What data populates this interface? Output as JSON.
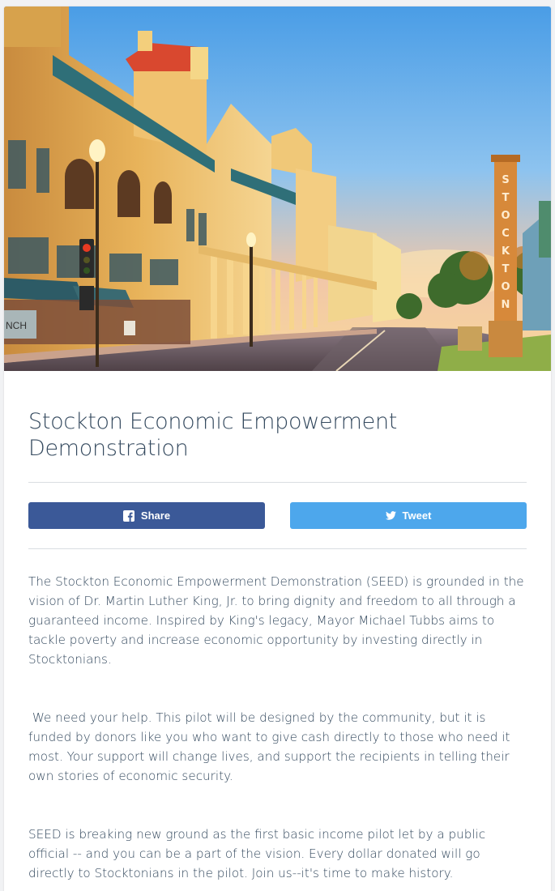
{
  "hero": {
    "image_alt": "Stockton street with historic hotel building and STOCKTON sign tower",
    "tower_letters": [
      "S",
      "T",
      "O",
      "C",
      "K",
      "T",
      "O",
      "N"
    ],
    "storefront_text": "NCH"
  },
  "campaign": {
    "title": "Stockton Economic Empowerment Demonstration"
  },
  "share": {
    "facebook_label": "Share",
    "facebook_icon": "facebook-icon",
    "facebook_color": "#3b5998",
    "twitter_label": "Tweet",
    "twitter_icon": "twitter-icon",
    "twitter_color": "#4da7ec"
  },
  "description": {
    "paragraph_1": "The Stockton Economic Empowerment Demonstration (SEED) is grounded in the vision of Dr. Martin Luther King, Jr. to bring dignity and freedom to all through a guaranteed income. Inspired by King's legacy, Mayor Michael Tubbs aims to tackle poverty and increase economic opportunity by investing directly in Stocktonians.",
    "paragraph_2": " We need your help. This pilot will be designed by the community, but it is funded by donors like you who want to give cash directly to those who need it most. Your support will change lives, and support the recipients in telling their own stories of economic security.",
    "paragraph_3": "SEED is breaking new ground as the first basic income pilot let by a public official -- and you can be a part of the vision. Every dollar donated will go directly to Stocktonians in the pilot. Join us--it's time to make history."
  },
  "colors": {
    "title_text": "#34495e",
    "body_text": "#34495e",
    "divider": "#d9dde1"
  }
}
